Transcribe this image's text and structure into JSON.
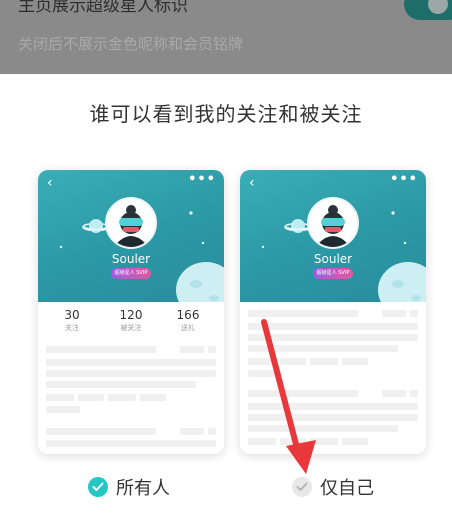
{
  "backdrop": {
    "title": "主页展示超级星人标识",
    "description": "关闭后不展示金色昵称和会员铭牌"
  },
  "sheet": {
    "title": "谁可以看到我的关注和被关注"
  },
  "profile": {
    "username": "Souler",
    "badge": "超级星人 SVIP",
    "stats": [
      {
        "value": "30",
        "label": "关注"
      },
      {
        "value": "120",
        "label": "被关注"
      },
      {
        "value": "166",
        "label": "送礼"
      }
    ]
  },
  "options": [
    {
      "label": "所有人",
      "selected": true
    },
    {
      "label": "仅自己",
      "selected": false
    }
  ],
  "colors": {
    "accent": "#25c6c4",
    "arrow": "#e8383b",
    "hero": "#2b98a5"
  },
  "icons": [
    "back-icon",
    "more-icon",
    "check-icon",
    "arrow-annotation"
  ]
}
